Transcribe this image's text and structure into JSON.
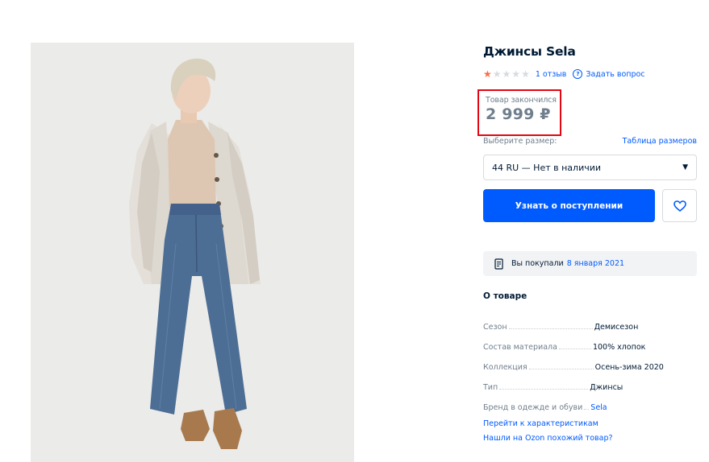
{
  "product": {
    "title": "Джинсы Sela",
    "rating": 1,
    "rating_max": 5,
    "reviews_label": "1 отзыв",
    "ask_label": "Задать вопрос",
    "ask_icon": "question-bubble-icon",
    "out_of_stock_label": "Товар закончился",
    "price": "2 999 ₽"
  },
  "size": {
    "label": "Выберите размер:",
    "table_link": "Таблица размеров",
    "selected": "44 RU — Нет в наличии"
  },
  "actions": {
    "notify_label": "Узнать о поступлении",
    "favorite_icon": "heart-icon"
  },
  "purchase": {
    "prefix": "Вы покупали",
    "date": "8 января 2021",
    "icon": "receipt-icon"
  },
  "about": {
    "title": "О товаре",
    "specs": [
      {
        "key": "Сезон",
        "value": "Демисезон"
      },
      {
        "key": "Состав материала",
        "value": "100% хлопок"
      },
      {
        "key": "Коллекция",
        "value": "Осень-зима 2020"
      },
      {
        "key": "Тип",
        "value": "Джинсы"
      },
      {
        "key": "Бренд в одежде и обуви",
        "value": "Sela"
      }
    ],
    "link_characteristics": "Перейти к характеристикам",
    "link_similar": "Нашли на Ozon похожий товар?"
  },
  "colors": {
    "accent": "#005bff",
    "price_highlight": "#e30613",
    "star_active": "#f96c4e",
    "muted_text": "#707f8d"
  }
}
